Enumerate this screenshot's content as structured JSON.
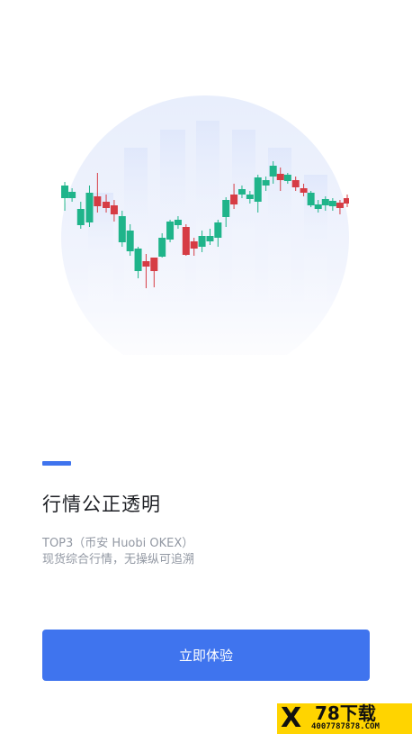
{
  "hero": {
    "illustration": "candlestick-chart-illustration",
    "colors": {
      "up": "#1fb48a",
      "down": "#d63c44",
      "circle": "#eef2fc"
    }
  },
  "feature": {
    "title": "行情公正透明",
    "subtitle_line1": "TOP3（币安 Huobi OKEX）",
    "subtitle_line2": "现货综合行情，无操纵可追溯"
  },
  "cta": {
    "label": "立即体验"
  },
  "watermark": {
    "brand": "78下载",
    "url": "4007787878.COM"
  },
  "colors": {
    "accent": "#3f74ee",
    "title": "#1d1f24",
    "subtitle": "#9298a3"
  }
}
